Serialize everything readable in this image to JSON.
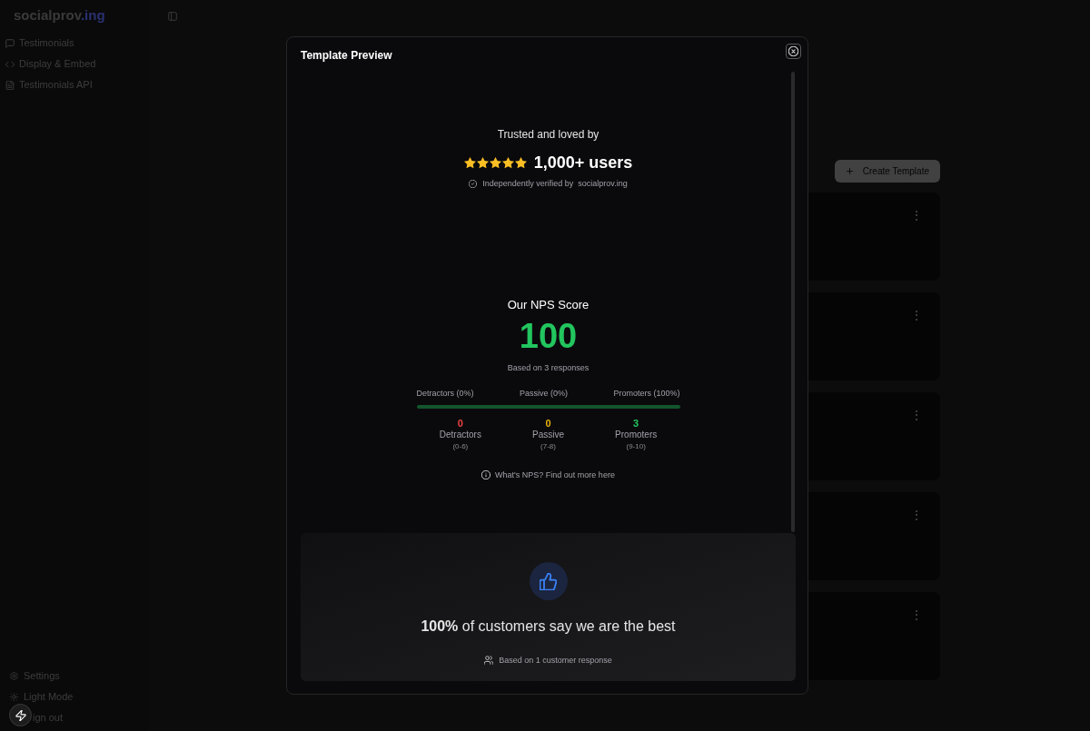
{
  "sidebar": {
    "logo": {
      "name": "socialprov",
      "accent": ".ing"
    },
    "nav": [
      {
        "kind": "message",
        "label": "Testimonials"
      },
      {
        "kind": "code",
        "label": "Display & Embed"
      },
      {
        "kind": "file",
        "label": "Testimonials API"
      }
    ],
    "footer": [
      {
        "kind": "gear",
        "label": "Settings"
      },
      {
        "kind": "sun",
        "label": "Light Mode"
      },
      {
        "kind": "covered",
        "label": "ign out"
      }
    ]
  },
  "main": {
    "create_button": "Create Template",
    "template_cards": [
      {
        "menu": "⋮"
      },
      {
        "menu": "⋮"
      },
      {
        "menu": "⋮"
      },
      {
        "menu": "⋮"
      },
      {
        "menu": "⋮"
      }
    ]
  },
  "modal": {
    "title": "Template Preview",
    "social_proof": {
      "heading": "Trusted and loved by",
      "stars": 5,
      "count": "1,000+ users",
      "verified_label": "Independently verified by",
      "verified_brand": "socialprov.ing"
    },
    "nps": {
      "title": "Our NPS Score",
      "score": "100",
      "basis": "Based on 3 responses",
      "segments": [
        {
          "label": "Detractors (0%)",
          "count": "0",
          "name": "Detractors",
          "range": "(0-6)",
          "color": "#ef4444"
        },
        {
          "label": "Passive (0%)",
          "count": "0",
          "name": "Passive",
          "range": "(7-8)",
          "color": "#eab308"
        },
        {
          "label": "Promoters (100%)",
          "level": 1,
          "count": "3",
          "name": "Promoters",
          "range": "(9-10)",
          "color": "#22c55e"
        }
      ],
      "help_link": "What's NPS? Find out more here"
    },
    "highlight": {
      "headline": "**100%** of customers say we are the best",
      "basis": "Based on 1 customer response"
    }
  }
}
